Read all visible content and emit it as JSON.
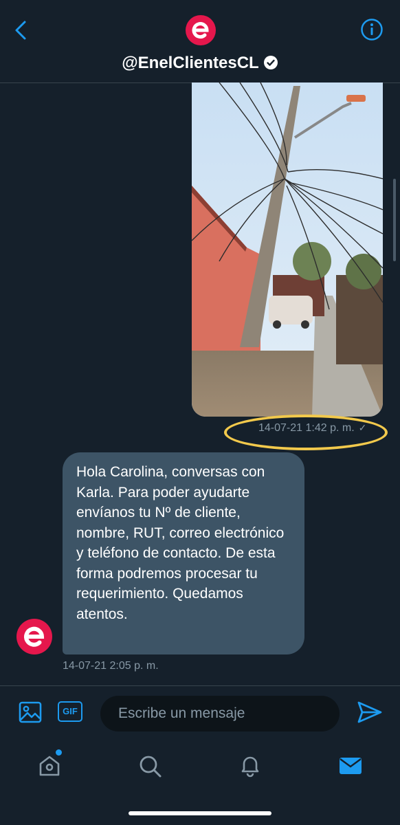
{
  "header": {
    "handle": "@EnelClientesCL",
    "back_icon": "chevron-left-icon",
    "info_icon": "info-icon",
    "accent": "#1d9bf0",
    "brand": "#e5174c"
  },
  "messages": [
    {
      "type": "image",
      "from": "me",
      "timestamp": "14-07-21 1:42 p. m.",
      "status": "✓",
      "highlight": "#f2c94c"
    },
    {
      "type": "text",
      "from": "@EnelClientesCL",
      "text": "Hola Carolina, conversas con Karla. Para poder ayudarte envíanos tu Nº de cliente, nombre, RUT, correo electrónico y teléfono de contacto. De esta forma podremos procesar tu requerimiento. Quedamos atentos.",
      "timestamp": "14-07-21 2:05 p. m."
    }
  ],
  "composer": {
    "gif_label": "GIF",
    "placeholder": "Escribe un mensaje"
  },
  "tabs": [
    "home-icon",
    "search-icon",
    "bell-icon",
    "mail-icon"
  ],
  "colors": {
    "background": "#15202b",
    "bubble": "#3d5466",
    "muted": "#8899a6"
  }
}
